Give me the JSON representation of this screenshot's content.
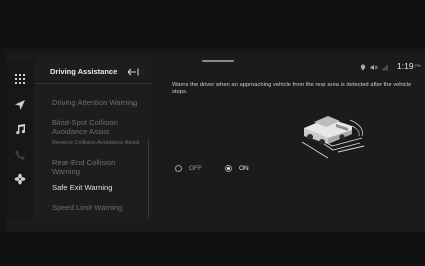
{
  "menu": {
    "title": "Driving Assistance",
    "back_icon": "back-arrow-icon",
    "items": [
      {
        "label": "Driving Attention Warning",
        "has_submenu": true
      },
      {
        "label": "Blind-Spot Collision Avoidance Assist"
      },
      {
        "label": "Reverse Collision-Avoidance Assist"
      },
      {
        "label": "Rear-End Collision Warning"
      },
      {
        "label": "Safe Exit Warning",
        "selected": true
      },
      {
        "label": "Speed Limit Warning"
      }
    ]
  },
  "rail": {
    "icons": [
      "grid-menu-icon",
      "navigation-icon",
      "music-icon",
      "phone-icon",
      "fan-icon"
    ]
  },
  "status": {
    "icons": [
      "location-icon",
      "mute-icon",
      "signal-icon"
    ],
    "time": "1:19",
    "ampm": "PM"
  },
  "content": {
    "description": "Warns the driver when an approaching vehicle from the rear area is detected after the vehicle stops.",
    "options": [
      {
        "label": "OFF",
        "selected": false
      },
      {
        "label": "ON",
        "selected": true
      }
    ]
  },
  "colors": {
    "background": "#151515",
    "panel": "#1d1d1d",
    "text_active": "#e0e0e0",
    "text_inactive": "#6e6e6e",
    "warning_zone": "#d8d8d8"
  }
}
